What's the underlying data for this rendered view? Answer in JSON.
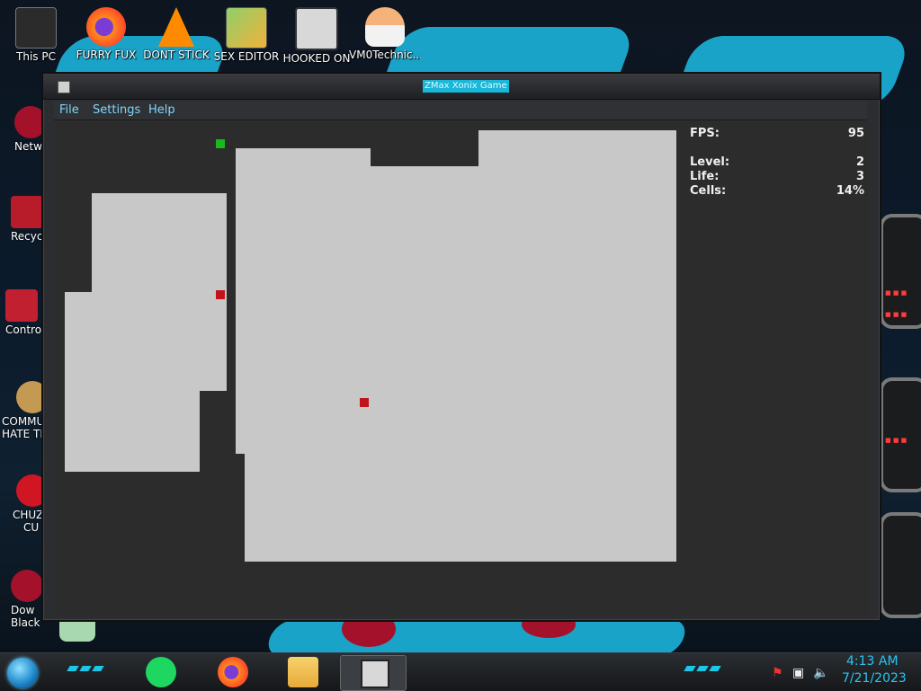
{
  "desktop": {
    "icons": [
      {
        "label": "This PC"
      },
      {
        "label": "FURRY FUX"
      },
      {
        "label": "DONT STICK"
      },
      {
        "label": "SEX EDITOR"
      },
      {
        "label": "HOOKED ON"
      },
      {
        "label": "VM0Technic..."
      }
    ],
    "left_icons": [
      {
        "label": "Netw"
      },
      {
        "label": "Recycl"
      },
      {
        "label": "Control"
      },
      {
        "label": "COMMU"
      },
      {
        "label": "HATE TH"
      },
      {
        "label": "CHUZ"
      },
      {
        "label": "CU"
      },
      {
        "label": "Dow"
      },
      {
        "label": "Black"
      }
    ]
  },
  "window": {
    "title": "ZMax Xonix Game",
    "menu": [
      "File",
      "Settings",
      "Help"
    ]
  },
  "stats": {
    "fps_label": "FPS:",
    "fps": "95",
    "level_label": "Level:",
    "level": "2",
    "life_label": "Life:",
    "life": "3",
    "cells_label": "Cells:",
    "cells": "14%"
  },
  "game": {
    "colors": {
      "captured": "#c8c8c8",
      "uncaptured": "#2c2c2c",
      "player": "#19b820",
      "enemy": "#c0141a"
    }
  },
  "taskbar": {
    "clock_time": "4:13 AM",
    "clock_date": "7/21/2023",
    "apps": [
      "spotify-icon",
      "firefox-icon",
      "file-explorer-icon",
      "xonix-app-icon"
    ],
    "tray": [
      "flag-icon",
      "network-icon",
      "volume-icon"
    ]
  },
  "theme": {
    "accent": "#29c5f0"
  }
}
